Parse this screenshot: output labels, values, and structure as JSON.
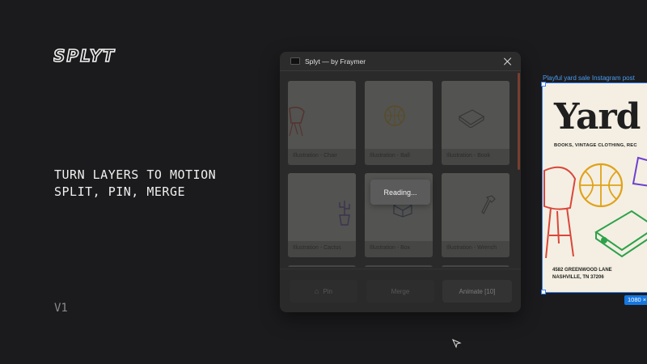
{
  "brand": {
    "logo_text": "SPLYT",
    "tagline_line1": "TURN LAYERS TO MOTION",
    "tagline_line2": "SPLIT, PIN, MERGE",
    "version": "V1"
  },
  "plugin": {
    "title": "Splyt — by Fraymer",
    "loading_text": "Reading...",
    "cards": [
      {
        "label": "Illustration - Chair",
        "icon": "chair-icon"
      },
      {
        "label": "Illustration - Ball",
        "icon": "ball-icon"
      },
      {
        "label": "Illustration - Book",
        "icon": "book-icon"
      },
      {
        "label": "Illustration - Cactus",
        "icon": "cactus-icon"
      },
      {
        "label": "Illustration - Box",
        "icon": "box-icon"
      },
      {
        "label": "Illustration - Wrench",
        "icon": "wrench-icon"
      }
    ],
    "footer": {
      "pin_label": "Pin",
      "merge_label": "Merge",
      "animate_label": "Animate [10]"
    },
    "accent_scroll": "#a34a34"
  },
  "canvas": {
    "frame_name": "Playful yard sale Instagram post",
    "poster_headline": "Yard",
    "poster_subline": "BOOKS, VINTAGE CLOTHING, REC",
    "poster_address_1": "4582 GREENWOOD LANE",
    "poster_address_2": "NASHVILLE, TN 37206",
    "size_tag": "1080 ×",
    "selection_color": "#3b82f6"
  }
}
